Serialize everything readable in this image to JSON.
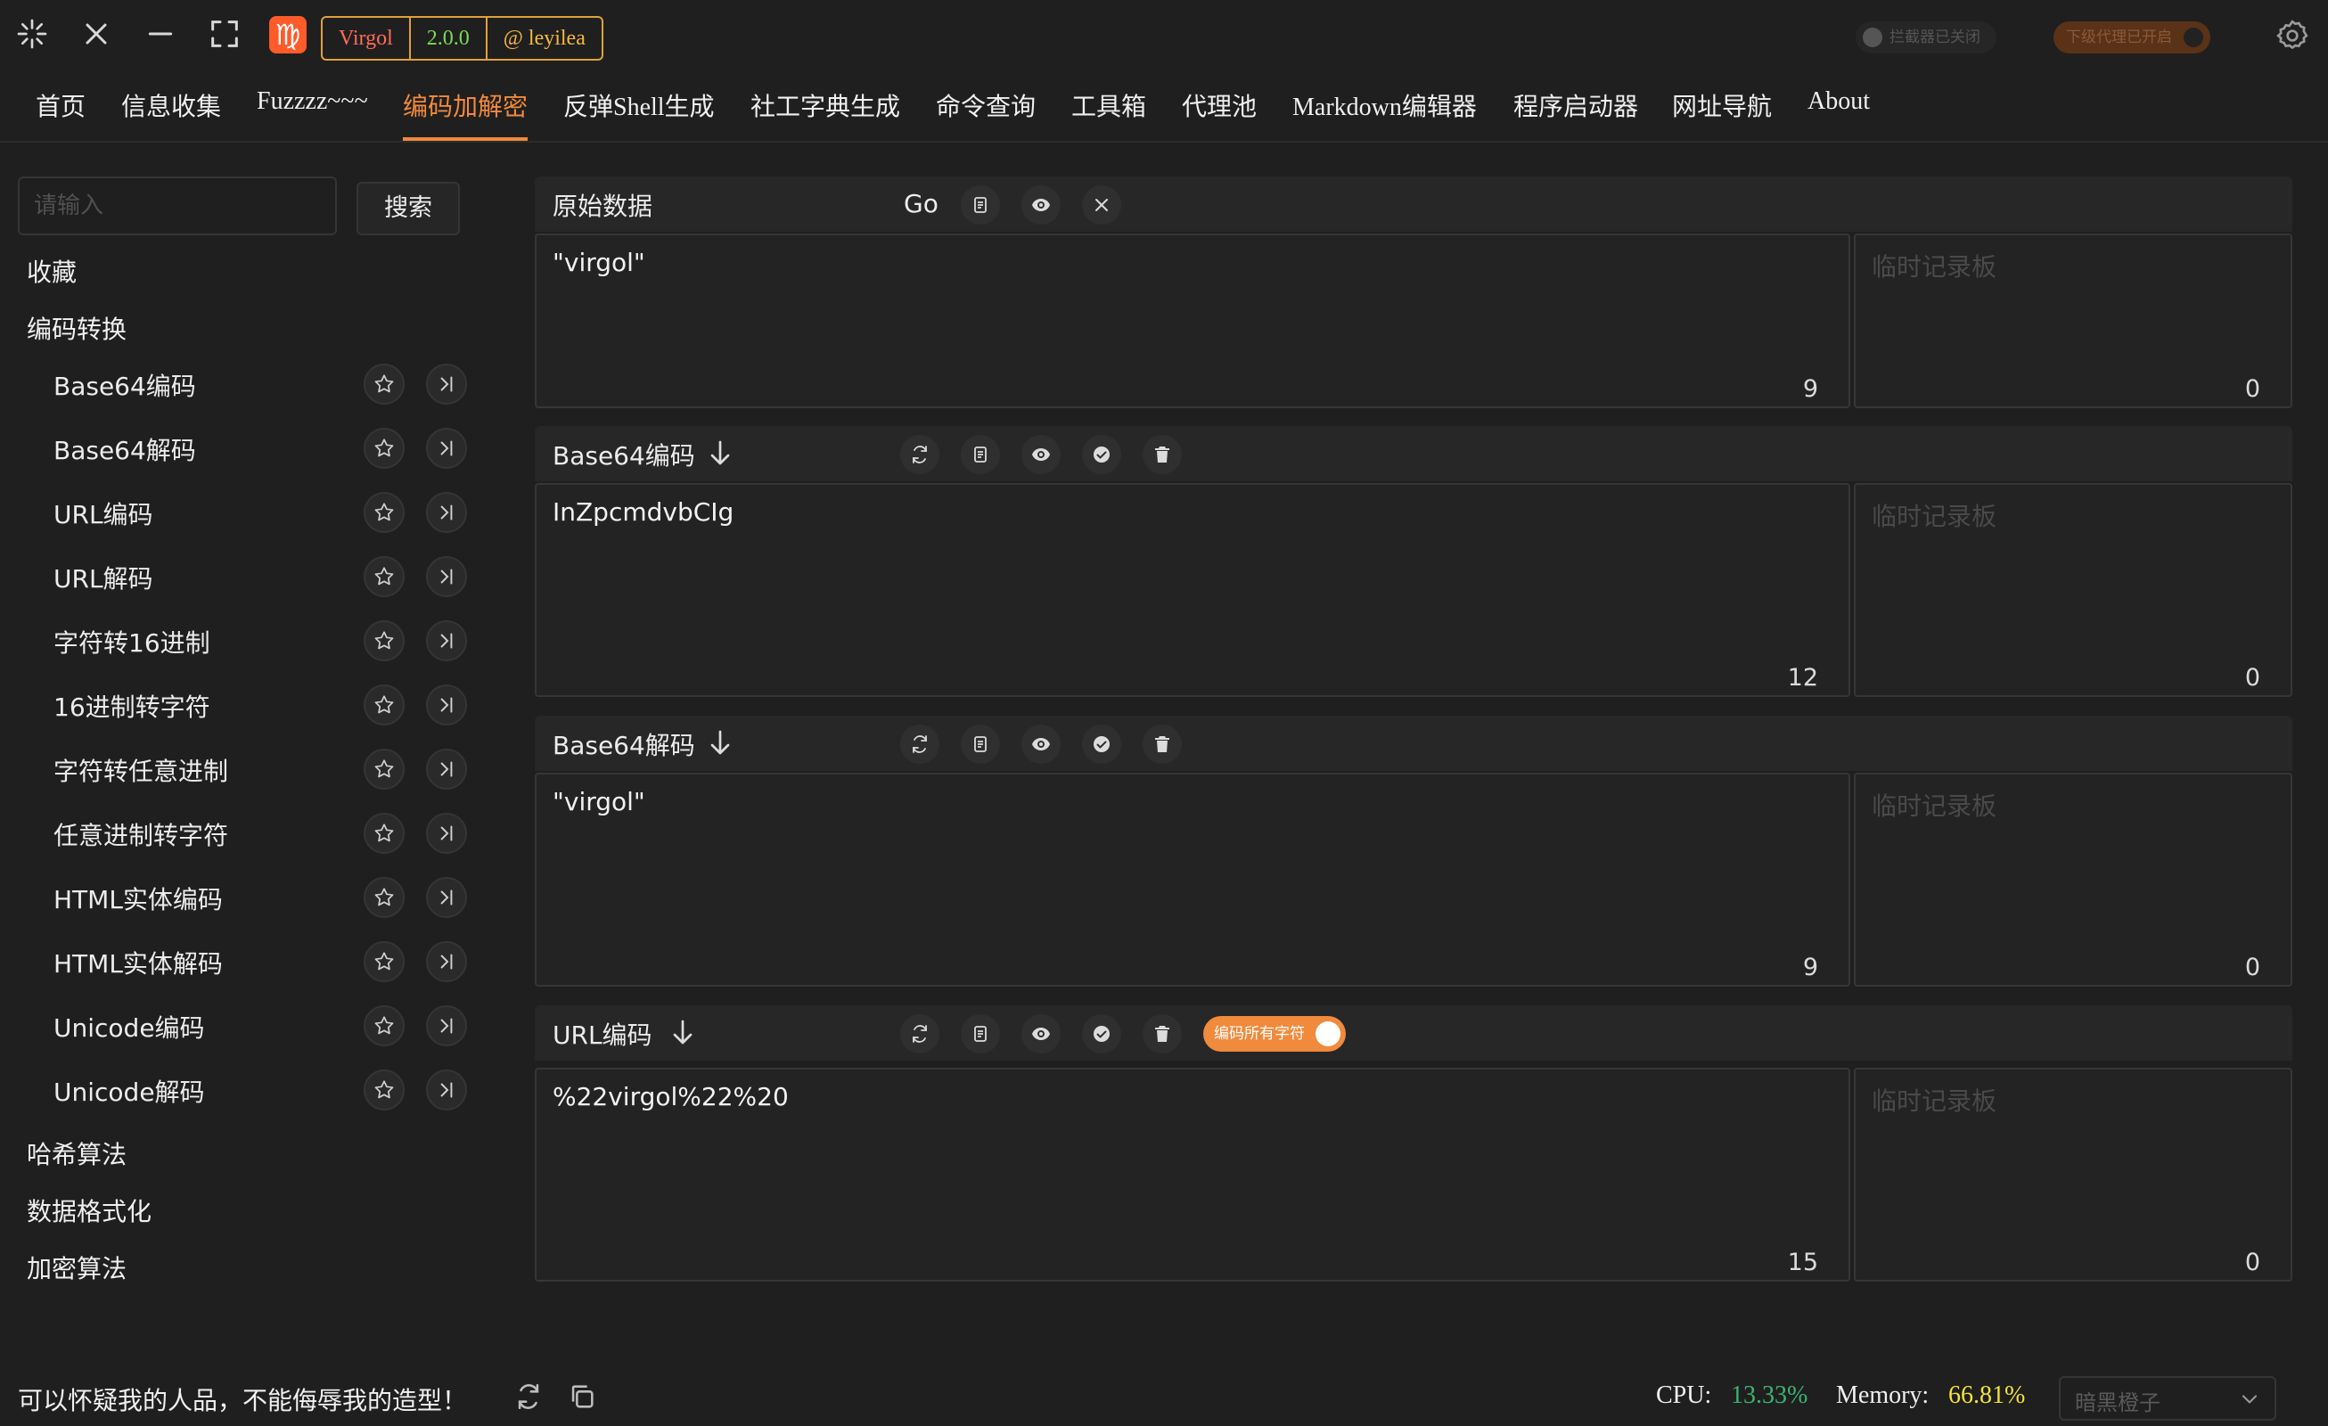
{
  "window": {
    "app_name": "Virgol",
    "version": "2.0.0",
    "author": "@ leyilea",
    "logo_glyph": "♍",
    "intercept_toggle": "拦截器已关闭",
    "proxy_toggle": "下级代理已开启"
  },
  "nav": {
    "items": [
      "首页",
      "信息收集",
      "Fuzzzz~~~",
      "编码加解密",
      "反弹Shell生成",
      "社工字典生成",
      "命令查询",
      "工具箱",
      "代理池",
      "Markdown编辑器",
      "程序启动器",
      "网址导航",
      "About"
    ],
    "active": "编码加解密"
  },
  "sidebar": {
    "search_placeholder": "请输入",
    "search_button": "搜索",
    "favorites": "收藏",
    "group_encoding": "编码转换",
    "items": [
      "Base64编码",
      "Base64解码",
      "URL编码",
      "URL解码",
      "字符转16进制",
      "16进制转字符",
      "字符转任意进制",
      "任意进制转字符",
      "HTML实体编码",
      "HTML实体解码",
      "Unicode编码",
      "Unicode解码"
    ],
    "group_hash": "哈希算法",
    "group_format": "数据格式化",
    "group_crypto": "加密算法"
  },
  "panels": [
    {
      "title": "原始数据",
      "go_label": "Go",
      "content": "\"virgol\"",
      "count": "9",
      "clip_placeholder": "临时记录板",
      "clip_count": "0"
    },
    {
      "title": "Base64编码",
      "content": "InZpcmdvbCIg",
      "count": "12",
      "clip_placeholder": "临时记录板",
      "clip_count": "0"
    },
    {
      "title": "Base64解码",
      "content": "\"virgol\"",
      "count": "9",
      "clip_placeholder": "临时记录板",
      "clip_count": "0"
    },
    {
      "title": "URL编码",
      "content": "%22virgol%22%20",
      "count": "15",
      "clip_placeholder": "临时记录板",
      "clip_count": "0",
      "encode_all_label": "编码所有字符"
    }
  ],
  "status": {
    "motto": "可以怀疑我的人品，不能侮辱我的造型！",
    "cpu_label": "CPU:",
    "cpu_value": "13.33%",
    "memory_label": "Memory:",
    "memory_value": "66.81%",
    "theme_value": "暗黑橙子"
  },
  "colors": {
    "accent": "#f08a3c",
    "cpu": "#3cb371",
    "memory": "#f4e23c",
    "badge_name": "#ff6b5a",
    "badge_version": "#7ed957",
    "badge_author": "#f4b942"
  }
}
